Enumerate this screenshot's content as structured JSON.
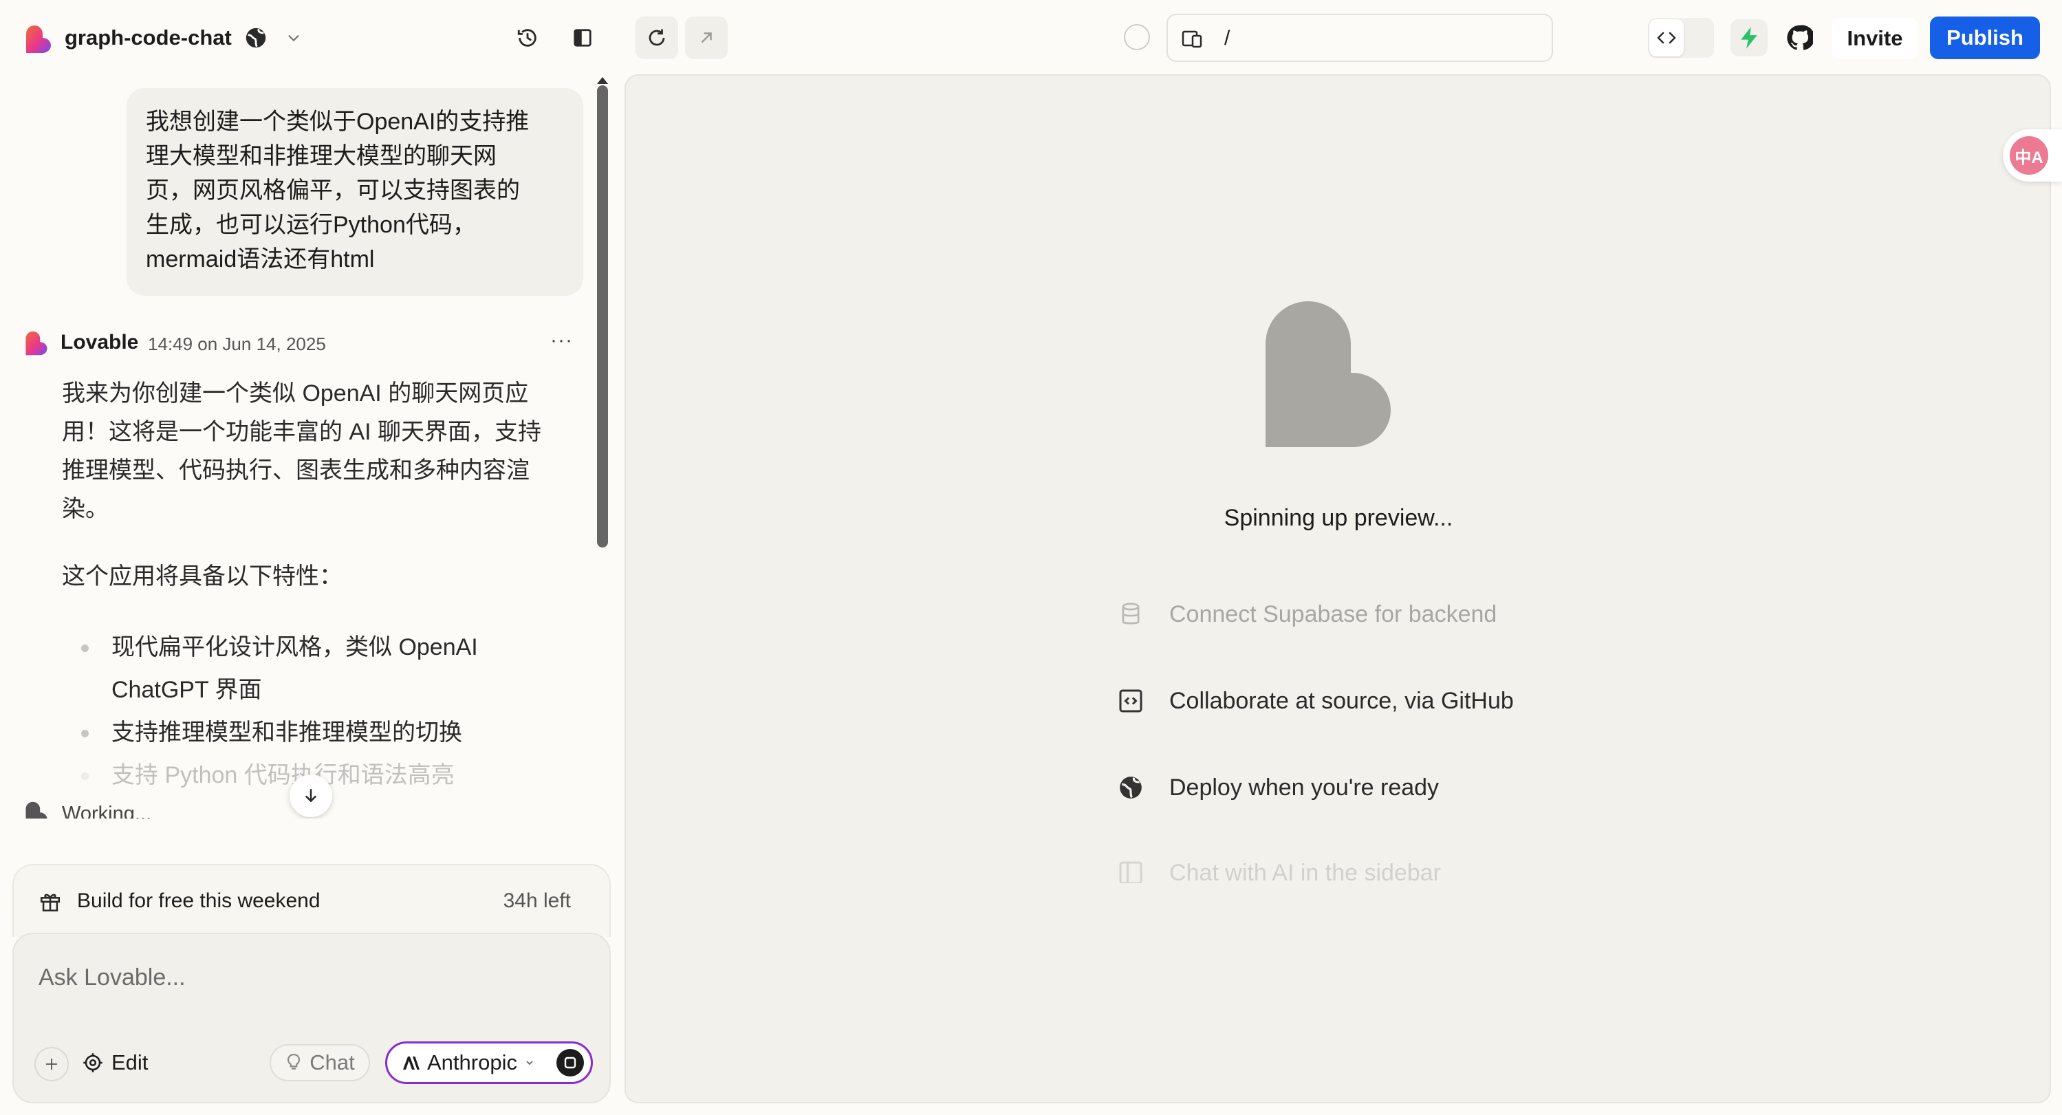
{
  "colors": {
    "brand_gradient": [
      "#f26b3a",
      "#e8388a",
      "#6f4cf5"
    ],
    "publish_blue": "#1660e7",
    "bolt_green": "#2ac269",
    "model_border": "#8a2bd1",
    "heart_gray": "#a9a7a1",
    "page_bg": "#fcfbf8",
    "preview_bg": "#f3f1ec"
  },
  "topbar": {
    "project_name": "graph-code-chat",
    "url_path": "/",
    "invite_label": "Invite",
    "publish_label": "Publish",
    "icons": [
      "history-icon",
      "sidebar-toggle-icon",
      "refresh-icon",
      "open-external-icon",
      "code-icon",
      "bolt-icon",
      "github-icon",
      "globe-icon",
      "device-icon"
    ]
  },
  "chat": {
    "user_message": [
      "我想创建一个类似于OpenAI的支持推",
      "理大模型和非推理大模型的聊天网",
      "页，网页风格偏平，可以支持图表的",
      "生成，也可以运行Python代码，",
      "mermaid语法还有html"
    ],
    "assistant": {
      "name": "Lovable",
      "time": "14:49 on Jun 14, 2025",
      "more": "···",
      "body_lines": [
        "我来为你创建一个类似 OpenAI 的聊天网页应",
        "用！这将是一个功能丰富的 AI 聊天界面，支持",
        "推理模型、代码执行、图表生成和多种内容渲",
        "染。"
      ],
      "features_intro": "这个应用将具备以下特性：",
      "features": [
        "现代扁平化设计风格，类似 OpenAI",
        "ChatGPT 界面",
        "支持推理模型和非推理模型的切换",
        "支持 Python 代码执行和语法高亮"
      ]
    },
    "working_text": "Working..."
  },
  "promo": {
    "label": "Build for free this weekend",
    "time_left": "34h left"
  },
  "composer": {
    "placeholder": "Ask Lovable...",
    "edit_label": "Edit",
    "chat_label": "Chat",
    "model_label": "Anthropic"
  },
  "preview": {
    "status": "Spinning up preview...",
    "tips": [
      {
        "icon": "database-icon",
        "text": "Connect Supabase for backend",
        "opacity": 0.35
      },
      {
        "icon": "code-box-icon",
        "text": "Collaborate at source, via GitHub",
        "opacity": 1
      },
      {
        "icon": "globe-icon",
        "text": "Deploy when you're ready",
        "opacity": 1
      },
      {
        "icon": "sidebar-icon",
        "text": "Chat with AI in the sidebar",
        "opacity": 0.15
      }
    ]
  },
  "translate_button": {
    "glyph": "中A"
  }
}
